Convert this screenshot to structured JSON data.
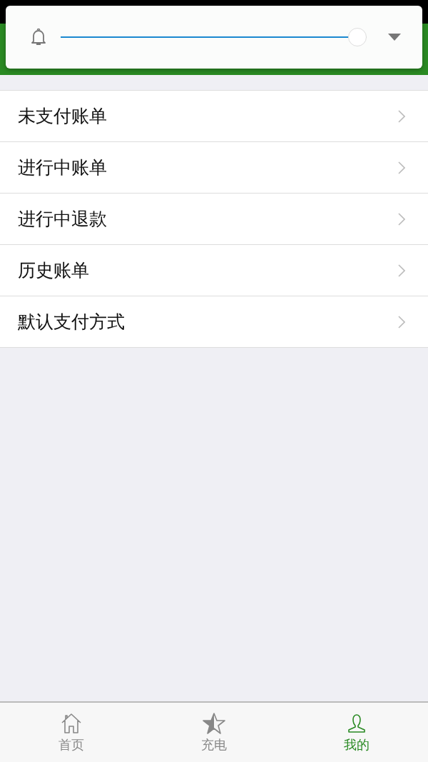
{
  "volume_panel": {
    "level": 0.97
  },
  "menu": [
    {
      "label": "未支付账单"
    },
    {
      "label": "进行中账单"
    },
    {
      "label": "进行中退款"
    },
    {
      "label": "历史账单"
    },
    {
      "label": "默认支付方式"
    }
  ],
  "tabs": [
    {
      "label": "首页",
      "kind": "home",
      "selected": false
    },
    {
      "label": "充电",
      "kind": "star",
      "selected": false
    },
    {
      "label": "我的",
      "kind": "person",
      "selected": true
    }
  ]
}
